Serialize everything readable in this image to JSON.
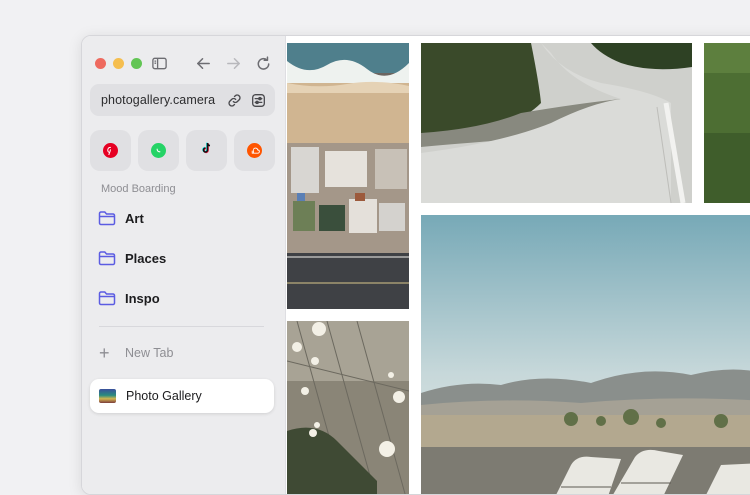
{
  "browser": {
    "toolbar": {
      "sidebar_toggle_icon": "sidebar-icon",
      "back_icon": "arrow-left-icon",
      "forward_icon": "arrow-right-icon",
      "reload_icon": "reload-icon"
    },
    "url": "photogallery.camera",
    "url_actions": [
      "link-icon",
      "sliders-icon"
    ]
  },
  "favorites": [
    {
      "name": "pinterest",
      "color": "#e60023"
    },
    {
      "name": "whatsapp",
      "color": "#25d366"
    },
    {
      "name": "tiktok",
      "color": "#111111"
    },
    {
      "name": "soundcloud",
      "color": "#ff5500"
    }
  ],
  "sidebar": {
    "section_title": "Mood Boarding",
    "folders": [
      {
        "label": "Art"
      },
      {
        "label": "Places"
      },
      {
        "label": "Inspo"
      }
    ],
    "new_tab_label": "New Tab",
    "active_tab_label": "Photo Gallery"
  },
  "colors": {
    "folder_icon": "#5b5ce2",
    "sidebar_bg": "#ececee"
  }
}
